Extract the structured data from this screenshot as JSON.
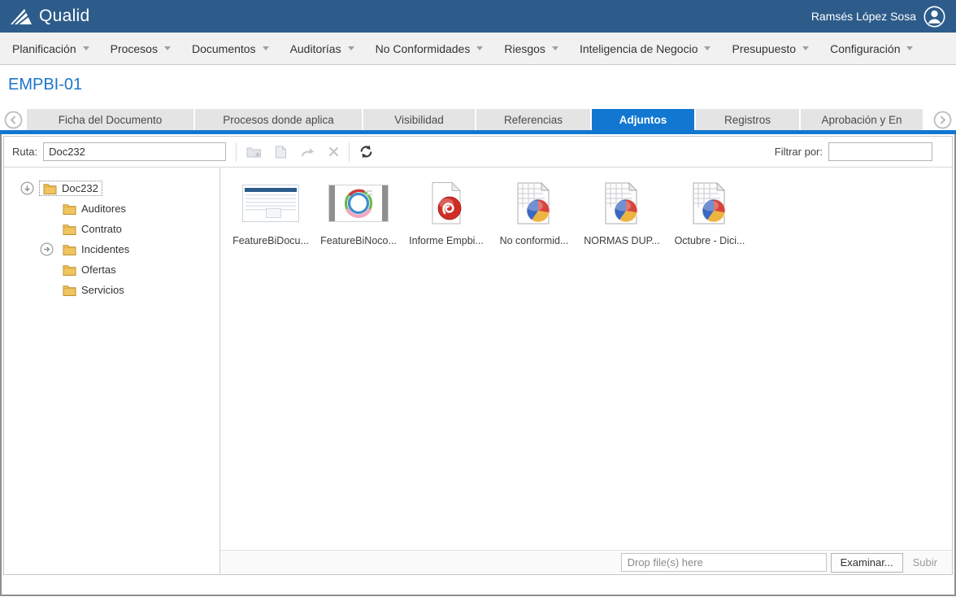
{
  "colors": {
    "header_bg": "#2d5c8a",
    "accent_blue": "#1177d1",
    "title_blue": "#1b76c9",
    "folder_yellow": "#f0c45f",
    "pdf_red": "#cf2e26",
    "pie_blue": "#3a67c0",
    "pie_red": "#d6453c",
    "pie_yellow": "#edb441"
  },
  "header": {
    "brand": "Qualid",
    "user_name": "Ramsés López Sosa"
  },
  "nav": {
    "items": [
      "Planificación",
      "Procesos",
      "Documentos",
      "Auditorías",
      "No Conformidades",
      "Riesgos",
      "Inteligencia de Negocio",
      "Presupuesto",
      "Configuración"
    ]
  },
  "page": {
    "title": "EMPBI-01"
  },
  "tabs": {
    "items": [
      "Ficha del Documento",
      "Procesos donde aplica",
      "Visibilidad",
      "Referencias",
      "Adjuntos",
      "Registros",
      "Aprobación y En"
    ],
    "active": "Adjuntos"
  },
  "toolbar": {
    "ruta_label": "Ruta:",
    "ruta_value": "Doc232",
    "filter_label": "Filtrar por:",
    "filter_value": "",
    "icons": [
      "new-folder-icon",
      "file-icon",
      "redo-arrow-icon",
      "delete-x-icon",
      "refresh-icon"
    ]
  },
  "tree": {
    "root_label": "Doc232",
    "children": [
      "Auditores",
      "Contrato",
      "Incidentes",
      "Ofertas",
      "Servicios"
    ]
  },
  "files": [
    {
      "name": "FeatureBiDocu...",
      "icon": "webpage-screenshot-thumbnail"
    },
    {
      "name": "FeatureBiNoco...",
      "icon": "rings-chart-thumbnail"
    },
    {
      "name": "Informe Empbi...",
      "icon": "pdf-file-icon"
    },
    {
      "name": "No conformid...",
      "icon": "spreadsheet-pie-file-icon"
    },
    {
      "name": "NORMAS DUP...",
      "icon": "spreadsheet-pie-file-icon"
    },
    {
      "name": "Octubre - Dici...",
      "icon": "spreadsheet-pie-file-icon"
    }
  ],
  "upload": {
    "placeholder": "Drop file(s) here",
    "browse_label": "Examinar...",
    "submit_label": "Subir"
  }
}
